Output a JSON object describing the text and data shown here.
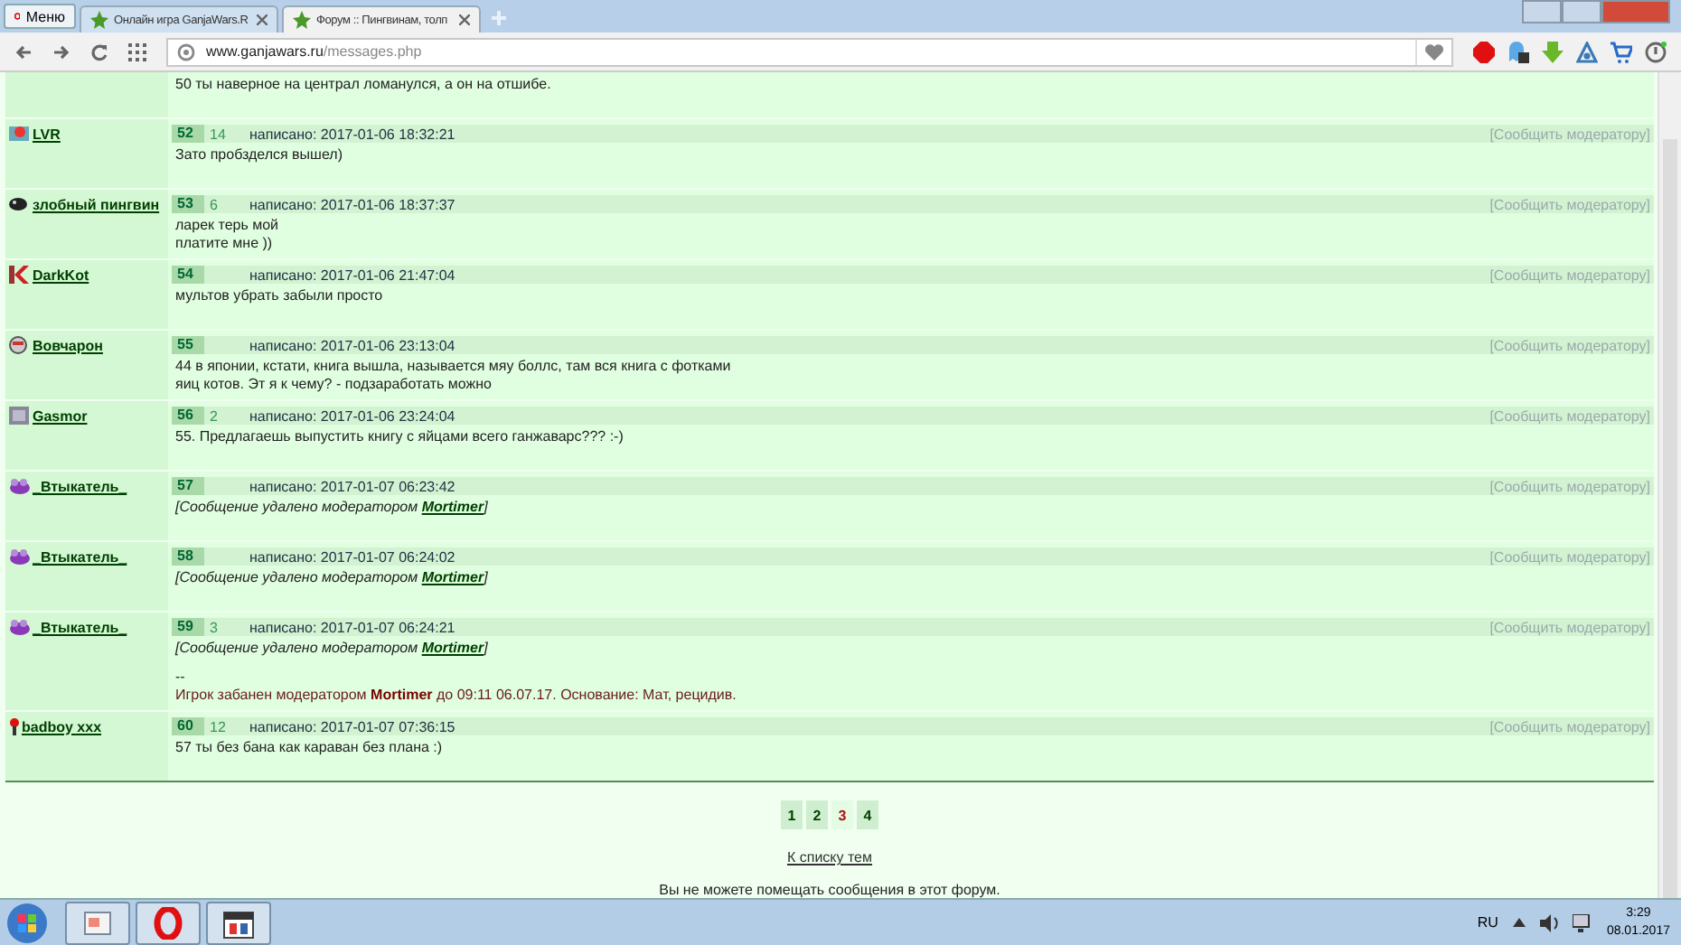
{
  "browser": {
    "menu_label": "Меню",
    "tabs": [
      {
        "label": "Онлайн игра GanjaWars.R",
        "selected": false
      },
      {
        "label": "Форум :: Пингвинам, толп",
        "selected": true
      }
    ],
    "url_domain": "www.ganjawars.ru",
    "url_path": "/messages.php"
  },
  "posts": [
    {
      "message": [
        {
          "kind": "text",
          "text": "50 ты наверное на централ ломанулся, а он на отшибе."
        }
      ]
    },
    {
      "author": "LVR",
      "number": "52",
      "score": "14",
      "date": "написано: 2017-01-06 18:32:21",
      "report": "[Сообщить модератору]",
      "message": [
        {
          "kind": "text",
          "text": "Зато пробзделся вышел)"
        }
      ]
    },
    {
      "author": "злобный пингвин",
      "number": "53",
      "score": "6",
      "date": "написано: 2017-01-06 18:37:37",
      "report": "[Сообщить модератору]",
      "message": [
        {
          "kind": "text",
          "text": "ларек терь мой"
        },
        {
          "kind": "text",
          "text": "платите мне ))"
        }
      ]
    },
    {
      "author": "DarkKot",
      "number": "54",
      "date": "написано: 2017-01-06 21:47:04",
      "report": "[Сообщить модератору]",
      "message": [
        {
          "kind": "text",
          "text": "мультов убрать забыли просто"
        }
      ]
    },
    {
      "author": "Вовчарон",
      "number": "55",
      "date": "написано: 2017-01-06 23:13:04",
      "report": "[Сообщить модератору]",
      "message": [
        {
          "kind": "text",
          "text": "44 в японии, кстати, книга вышла, называется мяу боллс, там вся книга с фотками"
        },
        {
          "kind": "text",
          "text": "яиц котов. Эт я к чему? - подзаработать можно"
        }
      ]
    },
    {
      "author": "Gasmor",
      "number": "56",
      "score": "2",
      "date": "написано: 2017-01-06 23:24:04",
      "report": "[Сообщить модератору]",
      "message": [
        {
          "kind": "text",
          "text": "55. Предлагаешь выпустить книгу с яйцами всего ганжаварс??? :-)"
        }
      ]
    },
    {
      "author": "_Втыкатель_",
      "number": "57",
      "date": "написано: 2017-01-07 06:23:42",
      "report": "[Сообщить модератору]",
      "message": [
        {
          "kind": "deleted",
          "text": "[Сообщение удалено модератором",
          "moderator": "Mortimer",
          "closing": "]"
        }
      ]
    },
    {
      "author": "_Втыкатель_",
      "number": "58",
      "date": "написано: 2017-01-07 06:24:02",
      "report": "[Сообщить модератору]",
      "message": [
        {
          "kind": "deleted",
          "text": "[Сообщение удалено модератором",
          "moderator": "Mortimer",
          "closing": "]"
        }
      ]
    },
    {
      "author": "_Втыкатель_",
      "number": "59",
      "score": "3",
      "date": "написано: 2017-01-07 06:24:21",
      "report": "[Сообщить модератору]",
      "message": [
        {
          "kind": "deleted",
          "text": "[Сообщение удалено модератором",
          "moderator": "Mortimer",
          "closing": "]"
        },
        {
          "kind": "separator",
          "text": "--"
        },
        {
          "kind": "ban",
          "text": "Игрок забанен модератором **Mortimer** до 09:11 06.07.17. Основание: Мат, рецидив."
        }
      ]
    },
    {
      "author": "badboy xxx",
      "number": "60",
      "score": "12",
      "date": "написано: 2017-01-07 07:36:15",
      "report": "[Сообщить модератору]",
      "message": [
        {
          "kind": "text",
          "text": "57 ты без бана как караван без плана :)"
        }
      ]
    }
  ],
  "pages": [
    {
      "label": "1",
      "selected": false
    },
    {
      "label": "2",
      "selected": false
    },
    {
      "label": "3",
      "selected": true
    },
    {
      "label": "4",
      "selected": false
    }
  ],
  "back_link": "К списку тем",
  "notice": "Вы не можете помещать сообщения в этот форум.",
  "taskbar": {
    "language": "RU",
    "time": "3:29",
    "date": "08.01.2017"
  }
}
